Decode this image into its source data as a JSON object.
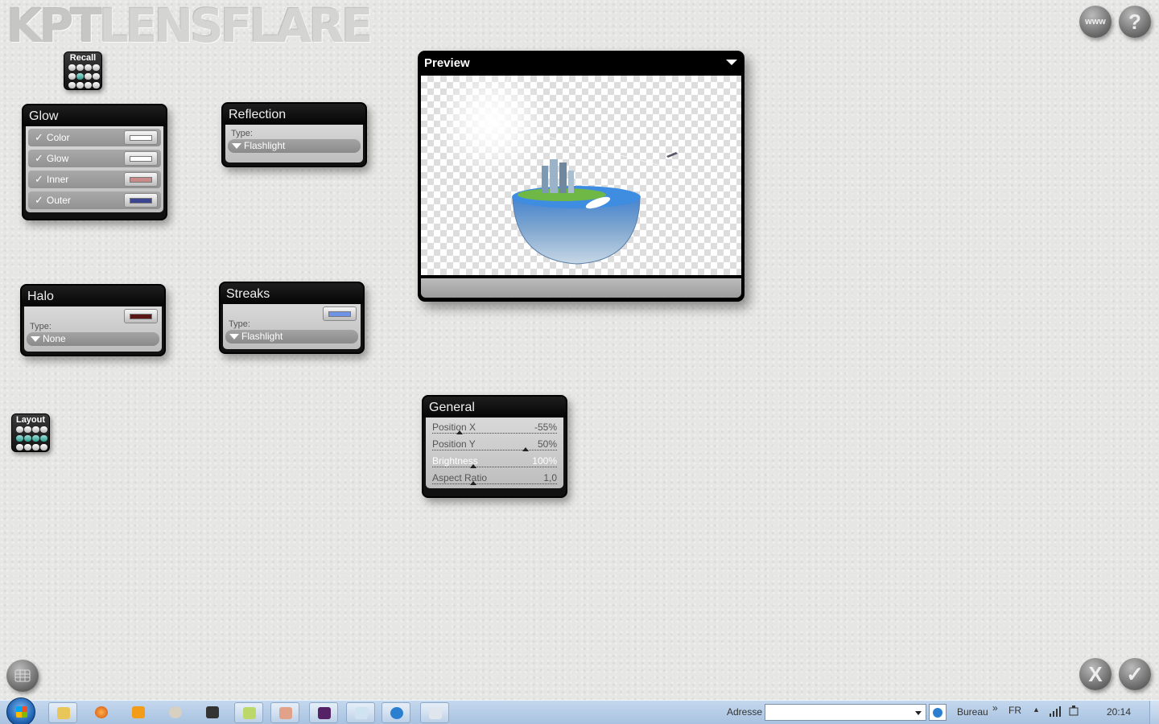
{
  "app": {
    "logo_bold": "KPT",
    "logo_light": "LENSFLARE"
  },
  "recall": {
    "label": "Recall"
  },
  "layout": {
    "label": "Layout"
  },
  "glow": {
    "title": "Glow",
    "rows": [
      {
        "label": "Color",
        "checked": true,
        "color": "#ffffff"
      },
      {
        "label": "Glow",
        "checked": true,
        "color": "#ffffff"
      },
      {
        "label": "Inner",
        "checked": true,
        "color": "#c98a8a"
      },
      {
        "label": "Outer",
        "checked": true,
        "color": "#3c4690"
      }
    ]
  },
  "reflection": {
    "title": "Reflection",
    "type_label": "Type:",
    "type_value": "Flashlight"
  },
  "halo": {
    "title": "Halo",
    "type_label": "Type:",
    "type_value": "None",
    "color": "#5a1515"
  },
  "streaks": {
    "title": "Streaks",
    "type_label": "Type:",
    "type_value": "Flashlight",
    "color": "#6f93e6"
  },
  "preview": {
    "title": "Preview"
  },
  "general": {
    "title": "General",
    "sliders": [
      {
        "label": "Position X",
        "value": "-55%",
        "level": 0.22
      },
      {
        "label": "Position Y",
        "value": "50%",
        "level": 0.75
      },
      {
        "label": "Brightness",
        "value": "100%",
        "level": 0.33
      },
      {
        "label": "Aspect Ratio",
        "value": "1,0",
        "level": 0.33
      }
    ]
  },
  "top_buttons": {
    "www": "www",
    "help": "?"
  },
  "bottom_buttons": {
    "cancel": "X",
    "ok": "✓"
  },
  "taskbar": {
    "address_label": "Adresse",
    "address_value": "",
    "bureau": "Bureau",
    "chevrons": "»",
    "lang": "FR",
    "clock": "20:14"
  },
  "colors": {
    "panel_bg": "#111111",
    "accent_teal": "#2a9a8c"
  }
}
